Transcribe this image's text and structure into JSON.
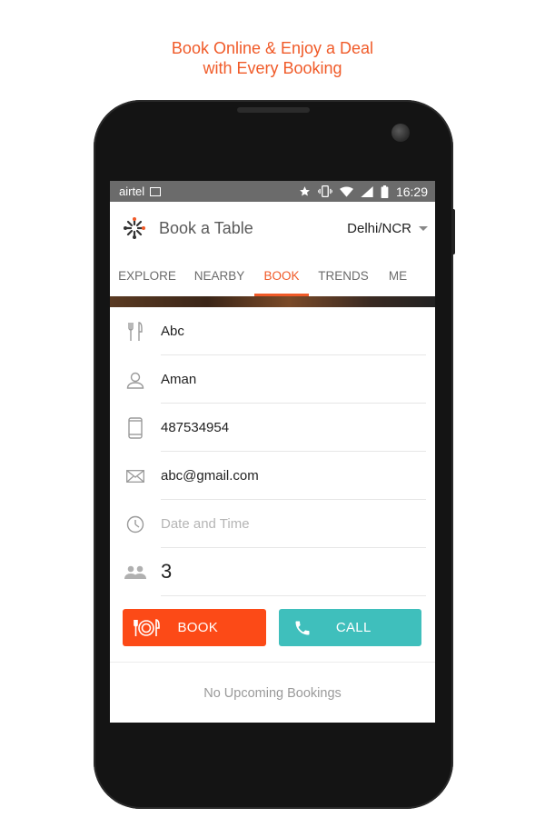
{
  "promo": {
    "line1": "Book Online & Enjoy a Deal",
    "line2": "with Every Booking"
  },
  "statusbar": {
    "carrier": "airtel",
    "time": "16:29",
    "icons": [
      "image-icon",
      "star-icon",
      "vibrate-icon",
      "wifi-icon",
      "signal-icon",
      "battery-icon"
    ]
  },
  "appbar": {
    "title": "Book a Table",
    "city": "Delhi/NCR"
  },
  "tabs": [
    {
      "label": "EXPLORE",
      "active": false
    },
    {
      "label": "NEARBY",
      "active": false
    },
    {
      "label": "BOOK",
      "active": true
    },
    {
      "label": "TRENDS",
      "active": false
    },
    {
      "label": "ME",
      "active": false
    }
  ],
  "form": {
    "restaurant": "Abc",
    "name": "Aman",
    "phone": "487534954",
    "email": "abc@gmail.com",
    "datetime_placeholder": "Date and Time",
    "guests": "3"
  },
  "actions": {
    "book_label": "BOOK",
    "call_label": "CALL"
  },
  "bookings": {
    "empty_text": "No Upcoming Bookings"
  },
  "colors": {
    "accent": "#f05a28",
    "book_button": "#fc4a17",
    "call_button": "#3fbfbc",
    "statusbar": "#6b6b6b"
  }
}
